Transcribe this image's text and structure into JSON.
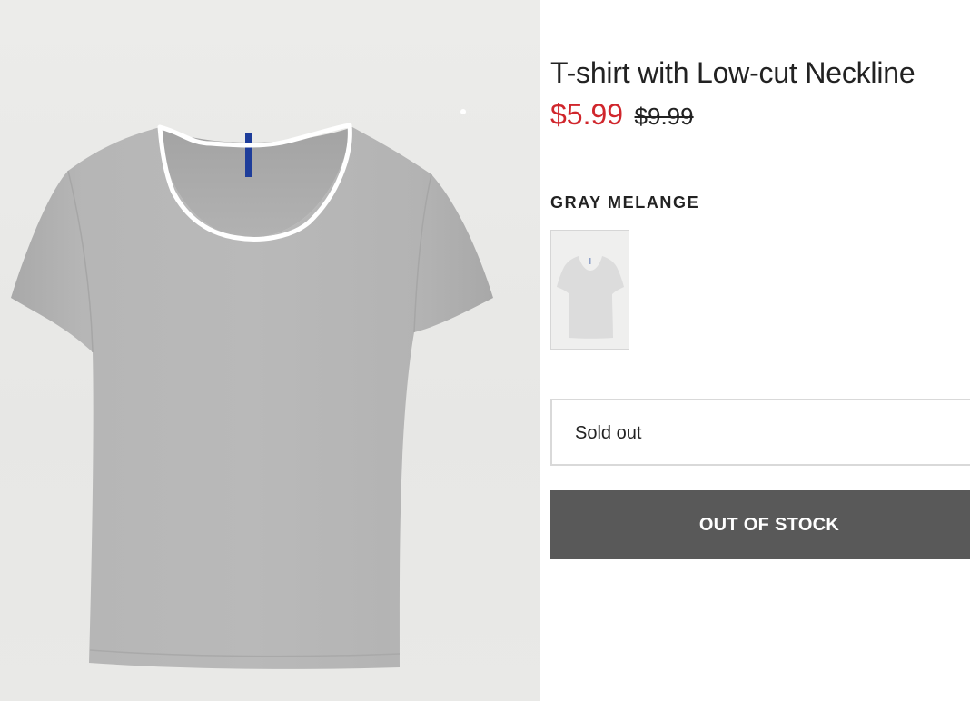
{
  "product": {
    "title": "T-shirt with Low-cut Neckline",
    "sale_price": "$5.99",
    "original_price": "$9.99",
    "color_name": "GRAY MELANGE"
  },
  "size_select": {
    "value": "Sold out"
  },
  "stock_button": {
    "label": "OUT OF STOCK"
  },
  "colors": {
    "sale_price": "#d0262c",
    "button_bg": "#595959",
    "shirt": "#b4b4b4",
    "background": "#eaeae8",
    "neckline_highlight": "#ffffff",
    "neck_tag": "#1e3d9a"
  },
  "icons": {
    "neckline_annotation": "white-outline-highlight"
  }
}
